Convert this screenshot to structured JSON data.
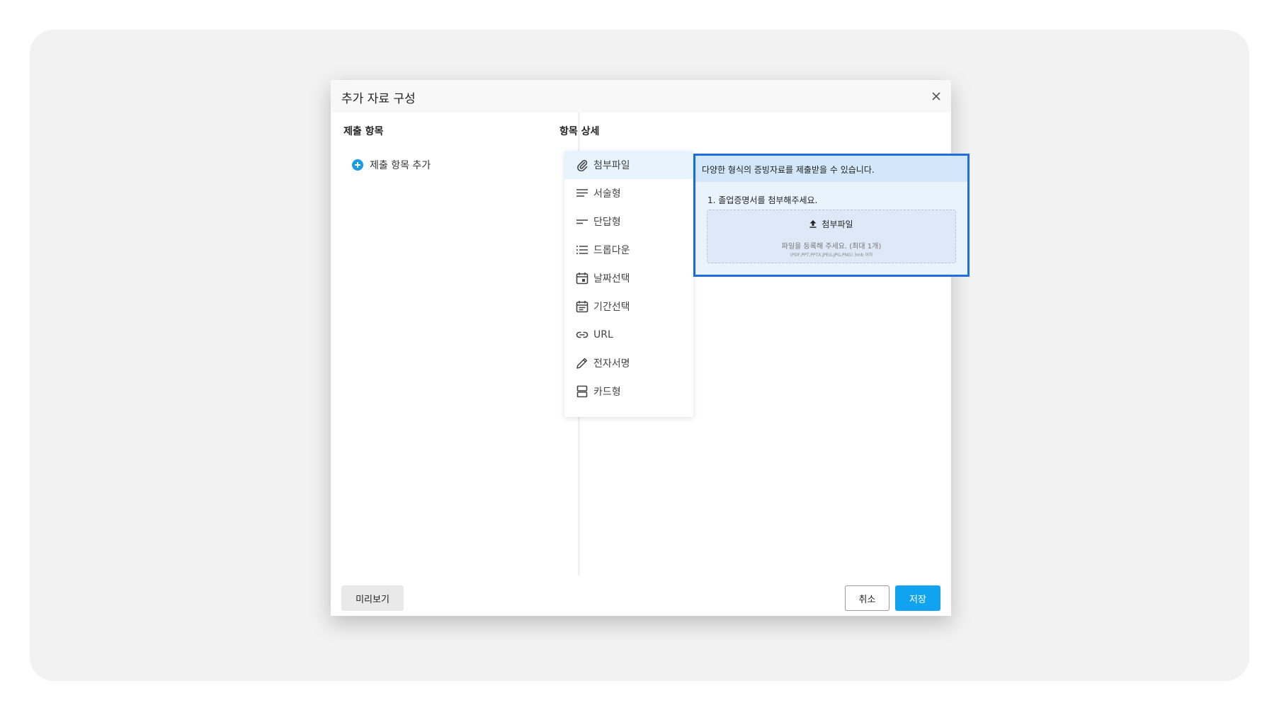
{
  "modal": {
    "title": "추가 자료 구성",
    "close_icon": "close-icon"
  },
  "left": {
    "section_title": "제출 항목",
    "add_item_label": "제출 항목 추가",
    "add_item_icon": "plus-circle-icon"
  },
  "right": {
    "section_title": "항목 상세"
  },
  "dropdown": {
    "selected": "첨부파일",
    "items": [
      {
        "label": "첨부파일",
        "icon": "paperclip-icon"
      },
      {
        "label": "서술형",
        "icon": "paragraph-lines-icon"
      },
      {
        "label": "단답형",
        "icon": "short-text-icon"
      },
      {
        "label": "드롭다운",
        "icon": "list-icon"
      },
      {
        "label": "날짜선택",
        "icon": "calendar-icon"
      },
      {
        "label": "기간선택",
        "icon": "calendar-range-icon"
      },
      {
        "label": "URL",
        "icon": "link-icon"
      },
      {
        "label": "전자서명",
        "icon": "pen-icon"
      },
      {
        "label": "카드형",
        "icon": "card-icon"
      }
    ]
  },
  "preview": {
    "header_text": "다양한 형식의 증빙자료를 제출받을 수 있습니다.",
    "question": "1.  졸업증명서를 첨부해주세요.",
    "upload_label": "첨부파일",
    "upload_hint": "파일을 등록해 주세요. (최대 1개)",
    "upload_formats": "(PDF,PPT,PPTX,JPEG,JPG,PNG) 3mb 이하"
  },
  "footer": {
    "preview_button": "미리보기",
    "cancel_button": "취소",
    "save_button": "저장"
  },
  "colors": {
    "accent": "#12a3f0",
    "highlight_border": "#1d6fe0",
    "selected_item_bg": "#e8f4fd"
  }
}
